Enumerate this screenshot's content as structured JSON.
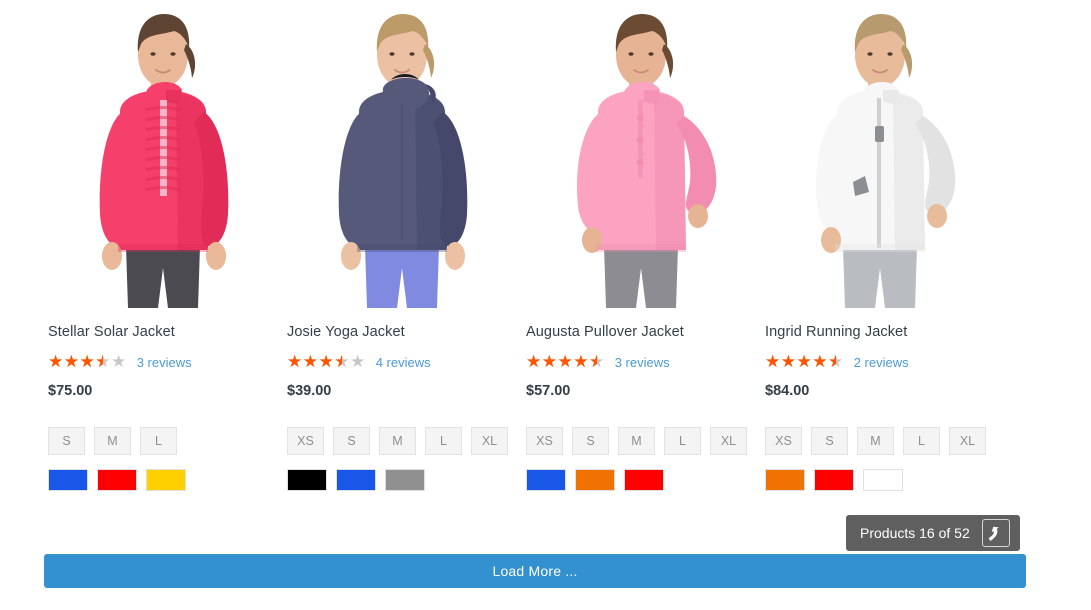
{
  "products": [
    {
      "name": "Stellar Solar Jacket",
      "rating_percent": 70,
      "reviews_label": "3 reviews",
      "price": "$75.00",
      "sizes": [
        "S",
        "M",
        "L"
      ],
      "colors": [
        "#1857e8",
        "#fe0000",
        "#ffd000"
      ],
      "image": {
        "alt": "stellar-solar-jacket-photo",
        "jacket_color": "#f4406a",
        "jacket_shadow": "#e02c57",
        "pants_color": "#4a4a50",
        "skin_color": "#e9b898",
        "hair_color": "#5d4433"
      }
    },
    {
      "name": "Josie Yoga Jacket",
      "rating_percent": 70,
      "reviews_label": "4 reviews",
      "price": "$39.00",
      "sizes": [
        "XS",
        "S",
        "M",
        "L",
        "XL"
      ],
      "colors": [
        "#000000",
        "#1857e8",
        "#909090"
      ],
      "image": {
        "alt": "josie-yoga-jacket-photo",
        "jacket_color": "#56597a",
        "jacket_shadow": "#45486a",
        "pants_color": "#7f8ae0",
        "skin_color": "#ecc0a2",
        "hair_color": "#bc9b68"
      }
    },
    {
      "name": "Augusta Pullover Jacket",
      "rating_percent": 90,
      "reviews_label": "3 reviews",
      "price": "$57.00",
      "sizes": [
        "XS",
        "S",
        "M",
        "L",
        "XL"
      ],
      "colors": [
        "#1857e8",
        "#ef7203",
        "#fe0000"
      ],
      "image": {
        "alt": "augusta-pullover-jacket-photo",
        "jacket_color": "#fba3c1",
        "jacket_shadow": "#f28cb0",
        "pants_color": "#8c8c92",
        "skin_color": "#e6b494",
        "hair_color": "#6b4b31"
      }
    },
    {
      "name": "Ingrid Running Jacket",
      "rating_percent": 90,
      "reviews_label": "2 reviews",
      "price": "$84.00",
      "sizes": [
        "XS",
        "S",
        "M",
        "L",
        "XL"
      ],
      "colors": [
        "#ef7203",
        "#fe0000",
        "#ffffff"
      ],
      "image": {
        "alt": "ingrid-running-jacket-photo",
        "jacket_color": "#f7f7f7",
        "jacket_shadow": "#e2e2e2",
        "pants_color": "#b9bcc0",
        "skin_color": "#e8bb9a",
        "hair_color": "#b79a6d"
      }
    }
  ],
  "toolbar": {
    "products_count_label": "Products 16 of 52",
    "to_top_icon": "arrow-up-icon"
  },
  "footer": {
    "load_more_label": "Load More ..."
  },
  "colors": {
    "accent_blue": "#3291ce",
    "star_filled": "#ff5501",
    "star_empty": "#c7c7c7",
    "link_blue": "#4c9ad6",
    "text_dark": "#333f48",
    "badge_gray": "#5f5f5f"
  }
}
